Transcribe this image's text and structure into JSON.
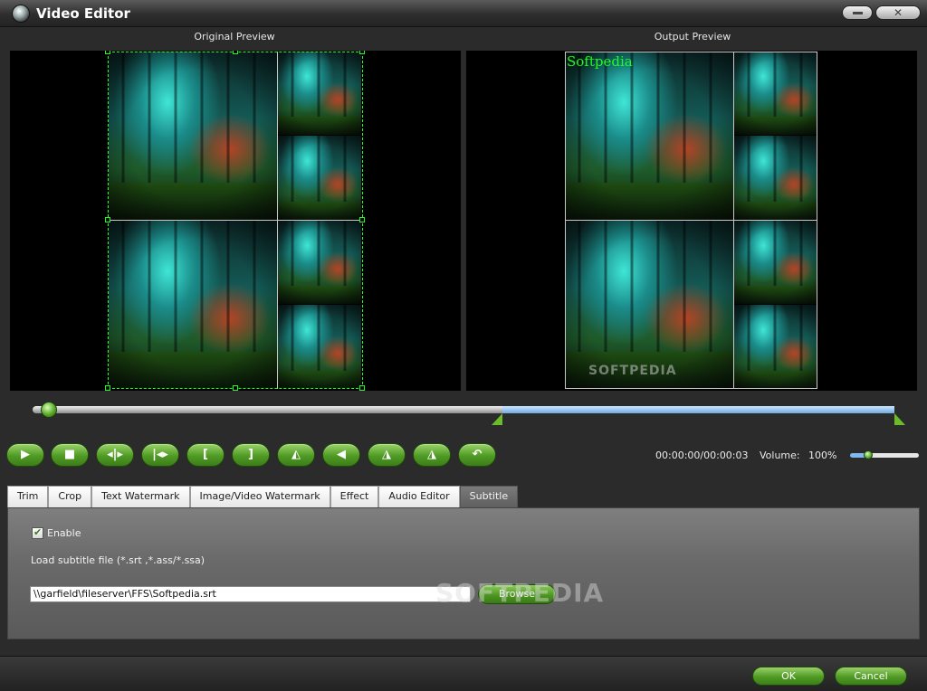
{
  "window": {
    "title": "Video Editor",
    "close_glyph": "✕"
  },
  "preview": {
    "original_label": "Original Preview",
    "output_label": "Output Preview",
    "text_watermark": "Softpedia",
    "image_watermark": "SOFTPEDIA"
  },
  "timeline": {
    "position_fraction": 0.02,
    "trim_start_fraction": 0.54,
    "trim_end_fraction": 1.0
  },
  "controls": {
    "buttons": [
      {
        "name": "play-button",
        "glyph": "▶"
      },
      {
        "name": "stop-button",
        "glyph": "■"
      },
      {
        "name": "prev-frame-button",
        "glyph": "◂|▸"
      },
      {
        "name": "next-frame-button",
        "glyph": "|◂▸"
      },
      {
        "name": "set-start-button",
        "glyph": "["
      },
      {
        "name": "set-end-button",
        "glyph": "]"
      },
      {
        "name": "flip-horizontal-button",
        "glyph": "◭"
      },
      {
        "name": "rotate-left-button",
        "glyph": "◀"
      },
      {
        "name": "flip-left-button",
        "glyph": "◮"
      },
      {
        "name": "flip-right-button",
        "glyph": "◮"
      },
      {
        "name": "undo-button",
        "glyph": "↶"
      }
    ],
    "timecode": "00:00:00/00:00:03",
    "volume_label": "Volume:",
    "volume_value": "100%",
    "volume_level_fraction": 0.25
  },
  "tabs": [
    {
      "label": "Trim",
      "active": false
    },
    {
      "label": "Crop",
      "active": false
    },
    {
      "label": "Text Watermark",
      "active": false
    },
    {
      "label": "Image/Video Watermark",
      "active": false
    },
    {
      "label": "Effect",
      "active": false
    },
    {
      "label": "Audio Editor",
      "active": false
    },
    {
      "label": "Subtitle",
      "active": true
    }
  ],
  "subtitle": {
    "enable_label": "Enable",
    "enabled": true,
    "load_label": "Load subtitle file (*.srt ,*.ass/*.ssa)",
    "file_path": "\\\\garfield\\fileserver\\FFS\\Softpedia.srt",
    "browse_label": "Browse",
    "watermark": "SOFTPEDIA"
  },
  "footer": {
    "ok_label": "OK",
    "cancel_label": "Cancel"
  }
}
